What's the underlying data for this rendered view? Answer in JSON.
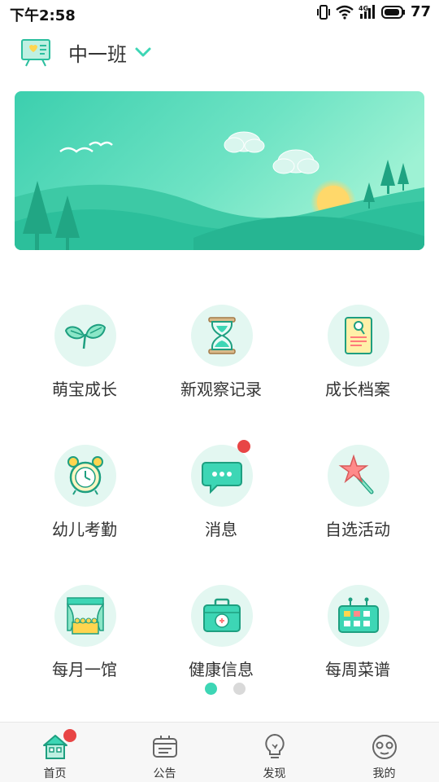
{
  "status_bar": {
    "time": "下午2:58",
    "battery": "77",
    "network": "4G"
  },
  "header": {
    "class_name": "中一班"
  },
  "colors": {
    "accent": "#3dd6b5",
    "badge": "#e84545",
    "pager_inactive": "#d9d9d9"
  },
  "grid": [
    {
      "label": "萌宝成长",
      "icon": "sprout-icon"
    },
    {
      "label": "新观察记录",
      "icon": "hourglass-icon"
    },
    {
      "label": "成长档案",
      "icon": "archive-folder-icon"
    },
    {
      "label": "幼儿考勤",
      "icon": "alarm-clock-icon"
    },
    {
      "label": "消息",
      "icon": "chat-bubble-icon",
      "badge": true
    },
    {
      "label": "自选活动",
      "icon": "star-wand-icon"
    },
    {
      "label": "每月一馆",
      "icon": "stage-icon"
    },
    {
      "label": "健康信息",
      "icon": "medical-kit-icon"
    },
    {
      "label": "每周菜谱",
      "icon": "menu-board-icon"
    }
  ],
  "pager": {
    "count": 2,
    "active_index": 0
  },
  "tabbar": [
    {
      "label": "首页",
      "icon": "home-icon",
      "active": true,
      "badge": true
    },
    {
      "label": "公告",
      "icon": "notice-icon"
    },
    {
      "label": "发现",
      "icon": "lightbulb-icon"
    },
    {
      "label": "我的",
      "icon": "profile-icon"
    }
  ]
}
